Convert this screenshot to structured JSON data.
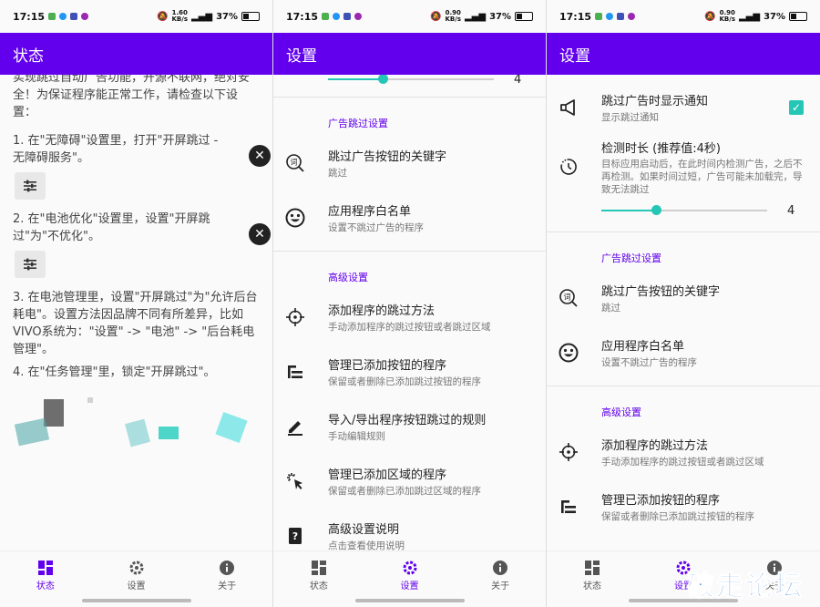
{
  "status_bar": {
    "time": "17:15",
    "speed_a": "1.60",
    "speed_b": "0.90",
    "speed_unit": "KB/s",
    "battery": "37%"
  },
  "screens": {
    "status": {
      "title": "状态",
      "intro": "实现跳过自动广告功能，开源不联网，绝对安全！为保证程序能正常工作，请检查以下设置：",
      "step1": "1. 在\"无障碍\"设置里，打开\"开屏跳过 - 无障碍服务\"。",
      "step2": "2. 在\"电池优化\"设置里，设置\"开屏跳过\"为\"不优化\"。",
      "step3": "3. 在电池管理里，设置\"开屏跳过\"为\"允许后台耗电\"。设置方法因品牌不同有所差异，比如VIVO系统为：\"设置\" -> \"电池\" -> \"后台耗电管理\"。",
      "step4": "4. 在\"任务管理\"里，锁定\"开屏跳过\"。"
    },
    "settings_mid": {
      "title": "设置",
      "slider_value": "4",
      "slider_fraction": 0.33,
      "section_ad": "广告跳过设置",
      "item_keyword_title": "跳过广告按钮的关键字",
      "item_keyword_sub": "跳过",
      "item_whitelist_title": "应用程序白名单",
      "item_whitelist_sub": "设置不跳过广告的程序",
      "section_adv": "高级设置",
      "item_add_title": "添加程序的跳过方法",
      "item_add_sub": "手动添加程序的跳过按钮或者跳过区域",
      "item_manage_btn_title": "管理已添加按钮的程序",
      "item_manage_btn_sub": "保留或者删除已添加跳过按钮的程序",
      "item_io_title": "导入/导出程序按钮跳过的规则",
      "item_io_sub": "手动编辑规则",
      "item_manage_area_title": "管理已添加区域的程序",
      "item_manage_area_sub": "保留或者删除已添加跳过区域的程序",
      "item_help_title": "高级设置说明",
      "item_help_sub": "点击查看使用说明"
    },
    "settings_top": {
      "title": "设置",
      "item_notify_title": "跳过广告时显示通知",
      "item_notify_sub": "显示跳过通知",
      "item_duration_title": "检测时长 (推荐值:4秒)",
      "item_duration_sub": "目标应用启动后，在此时间内检测广告，之后不再检测。如果时间过短，广告可能未加载完，导致无法跳过",
      "slider_value": "4",
      "slider_fraction": 0.33,
      "section_ad": "广告跳过设置",
      "item_keyword_title": "跳过广告按钮的关键字",
      "item_keyword_sub": "跳过",
      "item_whitelist_title": "应用程序白名单",
      "item_whitelist_sub": "设置不跳过广告的程序",
      "section_adv": "高级设置",
      "item_add_title": "添加程序的跳过方法",
      "item_add_sub": "手动添加程序的跳过按钮或者跳过区域",
      "item_manage_btn_title": "管理已添加按钮的程序",
      "item_manage_btn_sub": "保留或者删除已添加跳过按钮的程序"
    }
  },
  "nav": {
    "status": "状态",
    "settings": "设置",
    "about": "关于"
  },
  "watermark": "破走论坛",
  "colors": {
    "primary": "#6200ee",
    "accent": "#26c6b6"
  }
}
